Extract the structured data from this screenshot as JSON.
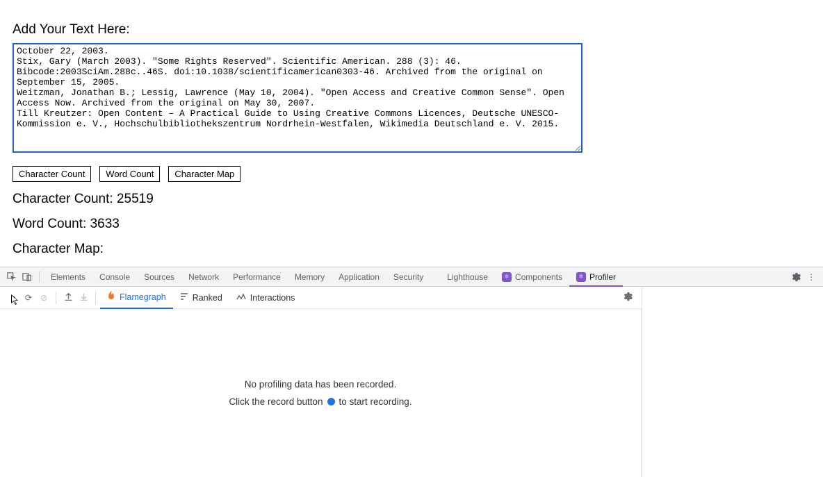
{
  "header": {
    "add_text_label": "Add Your Text Here:"
  },
  "textarea": {
    "value": "October 22, 2003.\nStix, Gary (March 2003). \"Some Rights Reserved\". Scientific American. 288 (3): 46.\nBibcode:2003SciAm.288c..46S. doi:10.1038/scientificamerican0303-46. Archived from the original on\nSeptember 15, 2005.\nWeitzman, Jonathan B.; Lessig, Lawrence (May 10, 2004). \"Open Access and Creative Common Sense\". Open\nAccess Now. Archived from the original on May 30, 2007.\nTill Kreutzer: Open Content – A Practical Guide to Using Creative Commons Licences, Deutsche UNESCO-\nKommission e. V., Hochschulbibliothekszentrum Nordrhein-Westfalen, Wikimedia Deutschland e. V. 2015."
  },
  "buttons": {
    "char_count": "Character Count",
    "word_count": "Word Count",
    "char_map": "Character Map"
  },
  "stats": {
    "char_count_label": "Character Count: ",
    "char_count_value": "25519",
    "word_count_label": "Word Count: ",
    "word_count_value": "3633",
    "char_map_label": "Character Map:"
  },
  "devtools": {
    "tabs": {
      "elements": "Elements",
      "console": "Console",
      "sources": "Sources",
      "network": "Network",
      "performance": "Performance",
      "memory": "Memory",
      "application": "Application",
      "security": "Security",
      "lighthouse": "Lighthouse",
      "components": "Components",
      "profiler": "Profiler"
    }
  },
  "profiler": {
    "tabs": {
      "flamegraph": "Flamegraph",
      "ranked": "Ranked",
      "interactions": "Interactions"
    },
    "empty_main": "No profiling data has been recorded.",
    "empty_sub_pre": "Click the record button",
    "empty_sub_post": "to start recording."
  }
}
